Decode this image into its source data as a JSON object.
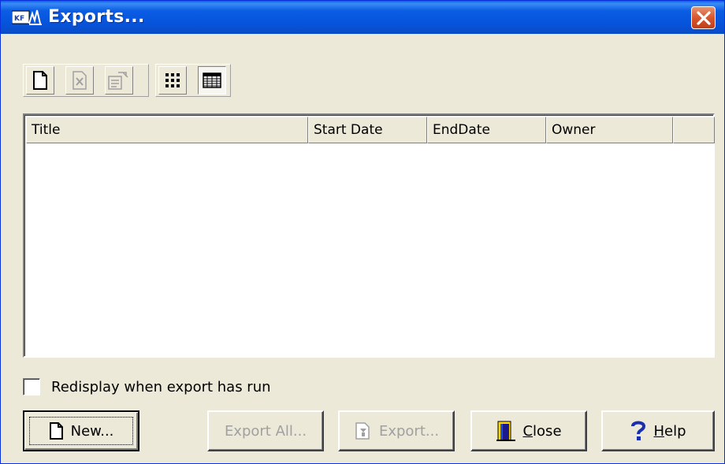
{
  "window": {
    "title": "Exports..."
  },
  "toolbar": {
    "buttons": [
      {
        "icon": "new-doc-icon",
        "enabled": true
      },
      {
        "icon": "delete-doc-icon",
        "enabled": false
      },
      {
        "icon": "properties-icon",
        "enabled": false
      },
      {
        "icon": "large-icons-view-icon",
        "pressed": false
      },
      {
        "icon": "details-view-icon",
        "pressed": true
      }
    ]
  },
  "list": {
    "columns": [
      "Title",
      "Start Date",
      "EndDate",
      "Owner",
      ""
    ],
    "rows": []
  },
  "redisplay": {
    "label": "Redisplay when export has run",
    "checked": false
  },
  "buttons": {
    "new": "New...",
    "export_all": "Export All...",
    "export": "Export...",
    "close_rest": "lose",
    "close_accel": "C",
    "help_rest": "elp",
    "help_accel": "H"
  }
}
